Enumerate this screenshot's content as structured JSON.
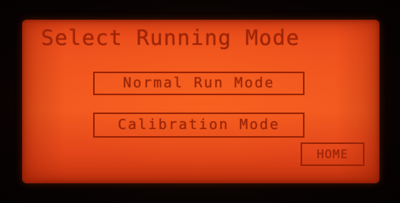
{
  "screen": {
    "title": "Select Running Mode"
  },
  "buttons": {
    "normal_run": "Normal Run Mode",
    "calibration": "Calibration Mode",
    "home": "HOME"
  },
  "colors": {
    "lcd_background": "#f0541e",
    "lcd_text": "#9e2406",
    "bezel": "#080302"
  }
}
